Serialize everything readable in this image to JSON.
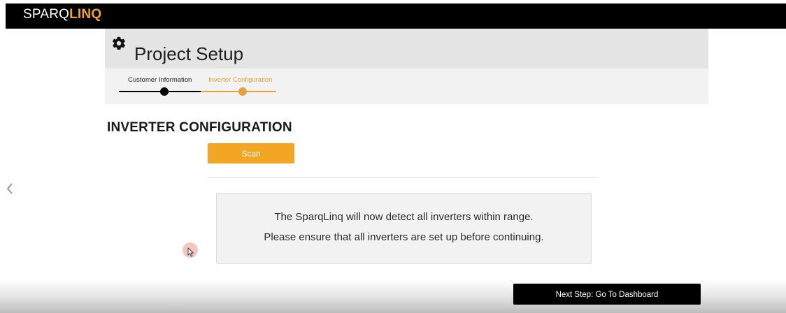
{
  "app": {
    "brand_prefix": "SPARQ",
    "brand_suffix": "LINQ"
  },
  "header": {
    "icon": "gear-icon",
    "title": "Project Setup"
  },
  "stepper": {
    "steps": [
      {
        "label": "Customer Information",
        "state": "completed"
      },
      {
        "label": "Inverter Configuration",
        "state": "active"
      }
    ]
  },
  "main": {
    "heading": "INVERTER CONFIGURATION",
    "scan_label": "Scan",
    "info_lines": [
      "The SparqLinq will now detect all inverters within range.",
      "Please ensure that all inverters are set up before continuing."
    ]
  },
  "footer": {
    "next_step_label": "Next Step: Go To Dashboard"
  },
  "colors": {
    "accent": "#f2a623",
    "topbar": "#000000",
    "header_band": "#e4e4e4",
    "header_panel": "#f2f2f2",
    "info_box": "#f2f2f2"
  }
}
